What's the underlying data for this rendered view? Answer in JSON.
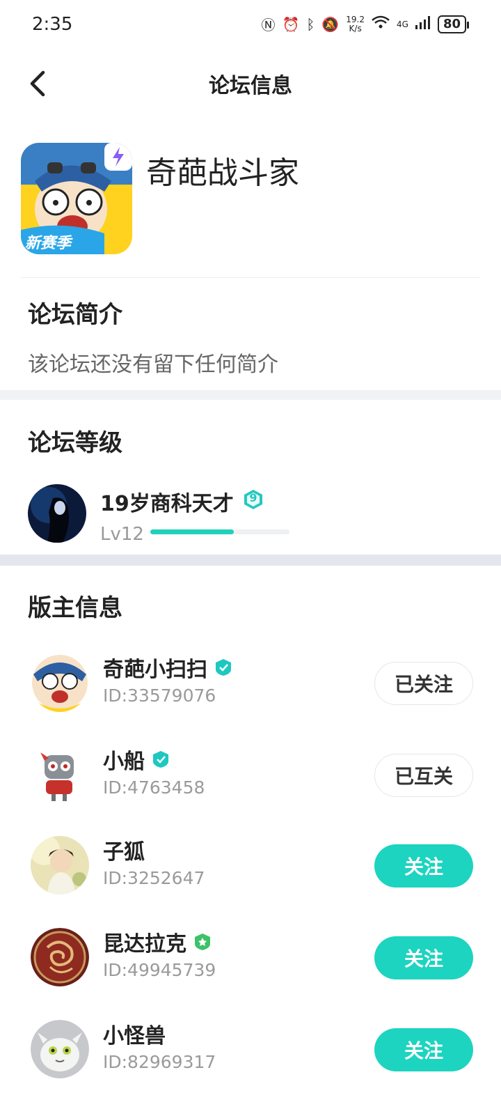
{
  "status_bar": {
    "time": "2:35",
    "speed_value": "19.2",
    "speed_unit": "K/s",
    "network": "4G",
    "battery": "80"
  },
  "header": {
    "title": "论坛信息"
  },
  "forum": {
    "name": "奇葩战斗家",
    "icon_text": "新赛季"
  },
  "intro": {
    "title": "论坛简介",
    "text": "该论坛还没有留下任何简介"
  },
  "level": {
    "title": "论坛等级",
    "user_name": "19岁商科天才",
    "badge_number": "9",
    "level_label": "Lv12",
    "progress": 0.6
  },
  "moderators": {
    "title": "版主信息",
    "list": [
      {
        "name": "奇葩小扫扫",
        "id": "ID:33579076",
        "button": "已关注",
        "verified": "blue"
      },
      {
        "name": "小船",
        "id": "ID:4763458",
        "button": "已互关",
        "verified": "blue"
      },
      {
        "name": "子狐",
        "id": "ID:3252647",
        "button": "关注",
        "verified": ""
      },
      {
        "name": "昆达拉克",
        "id": "ID:49945739",
        "button": "关注",
        "verified": "green"
      },
      {
        "name": "小怪兽",
        "id": "ID:82969317",
        "button": "关注",
        "verified": ""
      }
    ]
  },
  "colors": {
    "accent": "#1cd4bf",
    "progress": "#21d0b9",
    "band": "#f0f2f5"
  }
}
